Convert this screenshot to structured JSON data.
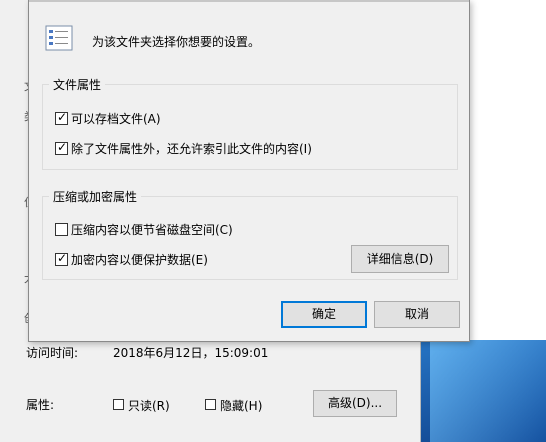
{
  "dialog": {
    "intro_text": "为该文件夹选择你想要的设置。",
    "file_attributes": {
      "legend": "文件属性",
      "archive_label": "可以存档文件(A)",
      "archive_checked": true,
      "index_label": "除了文件属性外，还允许索引此文件的内容(I)",
      "index_checked": true
    },
    "compress_encrypt": {
      "legend": "压缩或加密属性",
      "compress_label": "压缩内容以便节省磁盘空间(C)",
      "compress_checked": false,
      "encrypt_label": "加密内容以便保护数据(E)",
      "encrypt_checked": true,
      "details_button": "详细信息(D)"
    },
    "ok_button": "确定",
    "cancel_button": "取消"
  },
  "background_window": {
    "accessed_label": "访问时间:",
    "accessed_value": "2018年6月12日，15:09:01",
    "attributes_label": "属性:",
    "readonly_label": "只读(R)",
    "hidden_label": "隐藏(H)",
    "advanced_button": "高级(D)..."
  },
  "icons": {
    "settings_doc": "checklist-document-icon",
    "check": "checkmark-icon"
  }
}
